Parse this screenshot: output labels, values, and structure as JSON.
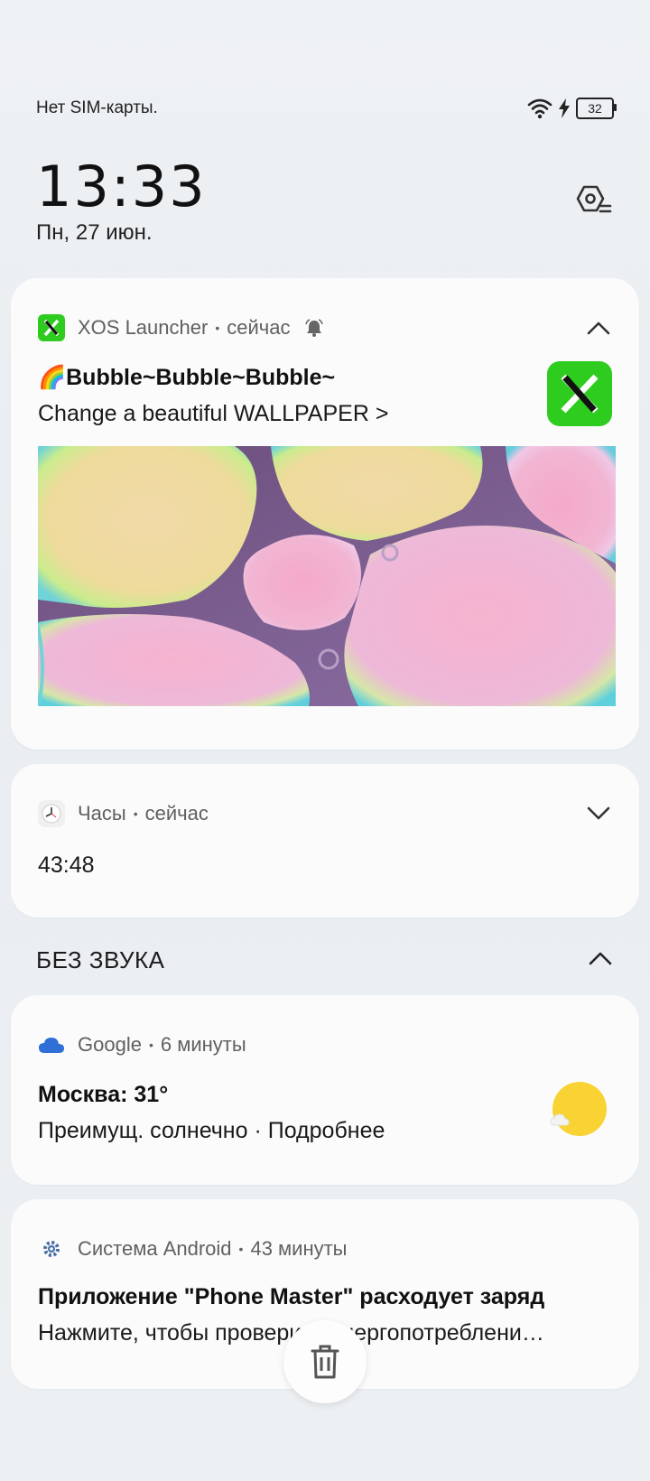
{
  "status_bar": {
    "carrier": "Нет SIM-карты.",
    "battery": "32",
    "icons": [
      "wifi-icon",
      "charging-icon",
      "battery-icon"
    ]
  },
  "lockscreen": {
    "time": "13:33",
    "date": "Пн, 27 июн."
  },
  "notifications": [
    {
      "app": "XOS Launcher",
      "time": "сейчас",
      "title": "🌈Bubble~Bubble~Bubble~",
      "body": "Change a beautiful WALLPAPER >",
      "accent": "#2ecc1f"
    },
    {
      "app": "Часы",
      "time": "сейчас",
      "body": "43:48"
    }
  ],
  "silent_section": {
    "label": "БЕЗ ЗВУКА",
    "notifications": [
      {
        "app": "Google",
        "time": "6 минуты",
        "title": "Москва: 31°",
        "body": "Преимущ. солнечно · Подробнее"
      },
      {
        "app": "Система Android",
        "time": "43 минуты",
        "title": "Приложение \"Phone Master\" расходует заряд",
        "body": "Нажмите, чтобы проверить энергопотреблени…"
      }
    ]
  },
  "colors": {
    "xos_green": "#2ecc1f",
    "google_blue": "#2f6fd6",
    "sun_yellow": "#f8d333"
  }
}
